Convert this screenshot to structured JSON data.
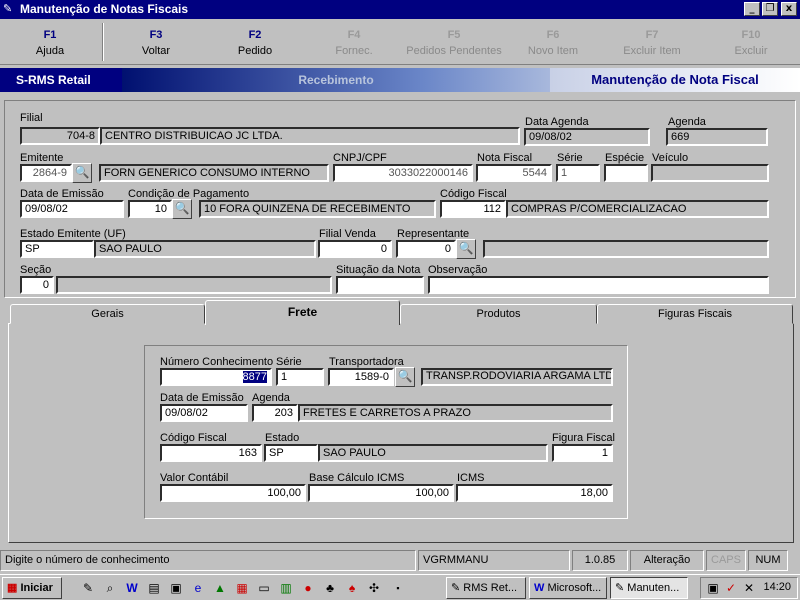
{
  "window": {
    "title": "Manutenção de Notas Fiscais",
    "controls": {
      "minimize": "_",
      "restore": "❐",
      "close": "x"
    }
  },
  "function_keys": [
    {
      "key": "F1",
      "label": "Ajuda",
      "enabled": true
    },
    {
      "key": "F3",
      "label": "Voltar",
      "enabled": true
    },
    {
      "key": "F2",
      "label": "Pedido",
      "enabled": true
    },
    {
      "key": "F4",
      "label": "Fornec.",
      "enabled": false
    },
    {
      "key": "F5",
      "label": "Pedidos Pendentes",
      "enabled": false
    },
    {
      "key": "F6",
      "label": "Novo Item",
      "enabled": false
    },
    {
      "key": "F7",
      "label": "Excluir Item",
      "enabled": false
    },
    {
      "key": "F10",
      "label": "Excluir",
      "enabled": false
    }
  ],
  "banner": {
    "product": "S-RMS Retail",
    "module": "Recebimento",
    "screen": "Manutenção de Nota Fiscal"
  },
  "header": {
    "filial": {
      "label": "Filial",
      "code": "704-8",
      "name": "CENTRO DISTRIBUICAO JC LTDA."
    },
    "data_agenda": {
      "label": "Data Agenda",
      "value": "09/08/02"
    },
    "agenda": {
      "label": "Agenda",
      "value": "669"
    },
    "emitente": {
      "label": "Emitente",
      "code": "2864-9",
      "name": "FORN GENERICO CONSUMO INTERNO"
    },
    "cnpj": {
      "label": "CNPJ/CPF",
      "value": "3033022000146"
    },
    "nota_fiscal": {
      "label": "Nota Fiscal",
      "value": "5544"
    },
    "serie": {
      "label": "Série",
      "value": "1"
    },
    "especie": {
      "label": "Espécie",
      "value": ""
    },
    "veiculo": {
      "label": "Veículo",
      "value": ""
    },
    "data_emissao": {
      "label": "Data de Emissão",
      "value": "09/08/02"
    },
    "cond_pagamento": {
      "label": "Condição de Pagamento",
      "code": "10",
      "desc": "10 FORA QUINZENA DE RECEBIMENTO"
    },
    "codigo_fiscal": {
      "label": "Código Fiscal",
      "code": "112",
      "desc": "COMPRAS P/COMERCIALIZACAO"
    },
    "estado_emitente": {
      "label": "Estado Emitente (UF)",
      "uf": "SP",
      "name": "SAO PAULO"
    },
    "filial_venda": {
      "label": "Filial Venda",
      "value": "0"
    },
    "representante": {
      "label": "Representante",
      "code": "0",
      "name": ""
    },
    "secao": {
      "label": "Seção",
      "code": "0",
      "name": ""
    },
    "situacao": {
      "label": "Situação da Nota",
      "value": ""
    },
    "observacao": {
      "label": "Observação",
      "value": ""
    }
  },
  "tabs": [
    {
      "label": "Gerais",
      "active": false
    },
    {
      "label": "Frete",
      "active": true
    },
    {
      "label": "Produtos",
      "active": false
    },
    {
      "label": "Figuras Fiscais",
      "active": false
    }
  ],
  "frete": {
    "numero_conhecimento": {
      "label": "Número Conhecimento",
      "value": "8877"
    },
    "serie": {
      "label": "Série",
      "value": "1"
    },
    "transportadora": {
      "label": "Transportadora",
      "code": "1589-0",
      "name": "TRANSP.RODOVIARIA ARGAMA LTDA"
    },
    "data_emissao": {
      "label": "Data de Emissão",
      "value": "09/08/02"
    },
    "agenda": {
      "label": "Agenda",
      "code": "203",
      "desc": "FRETES E CARRETOS A PRAZO"
    },
    "codigo_fiscal": {
      "label": "Código Fiscal",
      "value": "163"
    },
    "estado": {
      "label": "Estado",
      "uf": "SP",
      "name": "SAO PAULO"
    },
    "figura_fiscal": {
      "label": "Figura Fiscal",
      "value": "1"
    },
    "valor_contabil": {
      "label": "Valor Contábil",
      "value": "100,00"
    },
    "base_icms": {
      "label": "Base Cálculo ICMS",
      "value": "100,00"
    },
    "icms": {
      "label": "ICMS",
      "value": "18,00"
    }
  },
  "status": {
    "message": "Digite o número de conhecimento",
    "user": "VGRMMANU",
    "version": "1.0.85",
    "mode": "Alteração",
    "caps": "CAPS",
    "num": "NUM"
  },
  "taskbar": {
    "start": "Iniciar",
    "tasks": [
      "RMS Ret...",
      "Microsoft...",
      "Manuten..."
    ],
    "clock": "14:20"
  }
}
